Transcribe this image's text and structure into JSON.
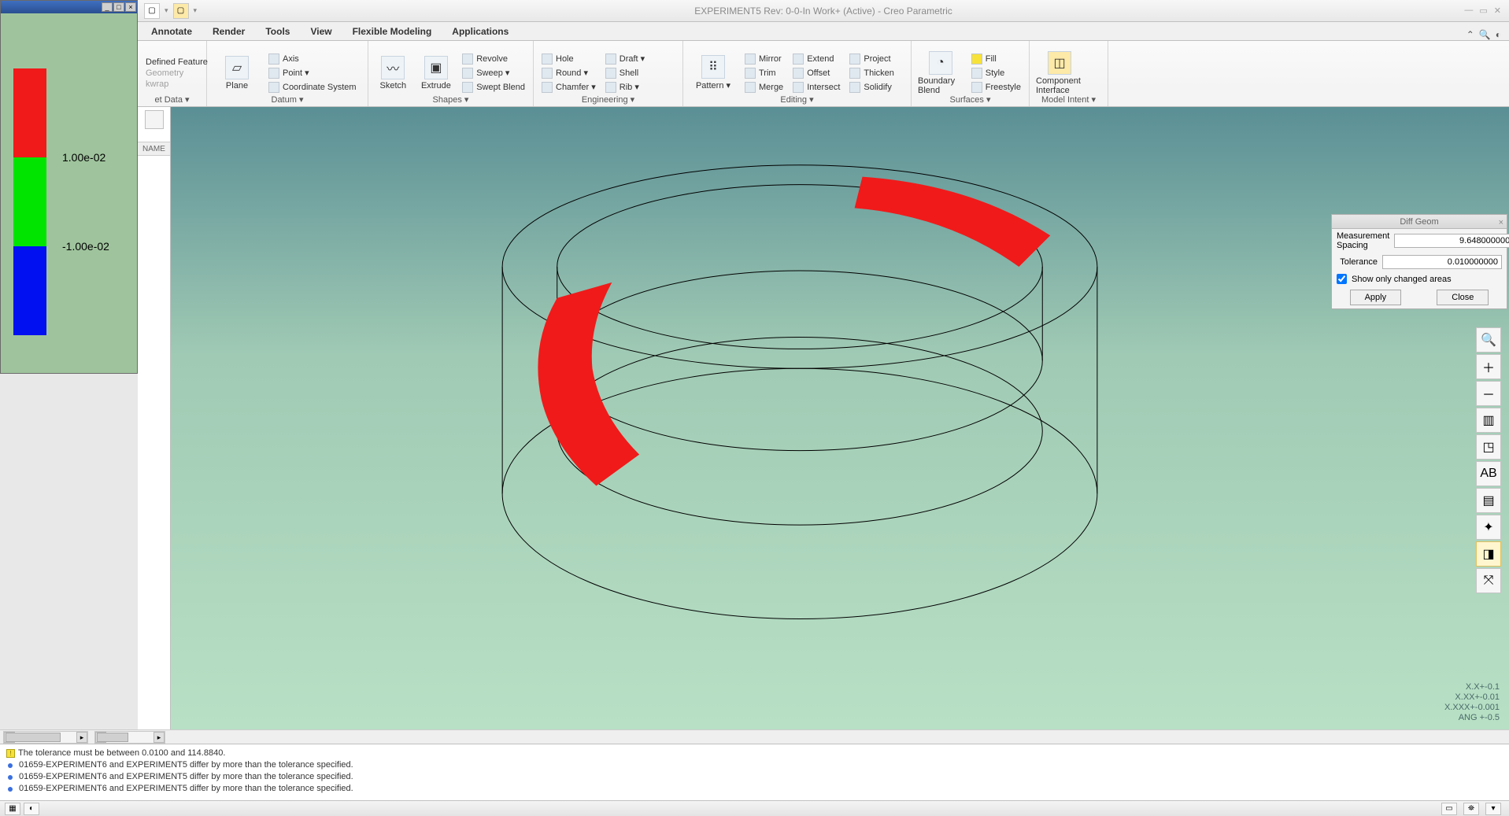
{
  "app": {
    "title": "EXPERIMENT5 Rev: 0-0-In Work+ (Active) - Creo Parametric"
  },
  "tabs": {
    "t0": "Annotate",
    "t1": "Render",
    "t2": "Tools",
    "t3": "View",
    "t4": "Flexible Modeling",
    "t5": "Applications"
  },
  "ribbon_groups": {
    "g0": "et Data ▾",
    "g1": "Datum ▾",
    "g2": "Shapes ▾",
    "g3": "Engineering ▾",
    "g4": "Editing ▾",
    "g5": "Surfaces ▾",
    "g6": "Model Intent ▾"
  },
  "rib": {
    "defined_feature": "Defined Feature",
    "geometry": "Geometry",
    "kwrap": "kwrap",
    "plane": "Plane",
    "axis": "Axis",
    "point": "Point ▾",
    "csys": "Coordinate System",
    "sketch": "Sketch",
    "extrude": "Extrude",
    "revolve": "Revolve",
    "sweep": "Sweep ▾",
    "swept_blend": "Swept Blend",
    "hole": "Hole",
    "round": "Round ▾",
    "chamfer": "Chamfer ▾",
    "draft": "Draft ▾",
    "shell": "Shell",
    "rib": "Rib ▾",
    "pattern": "Pattern ▾",
    "mirror": "Mirror",
    "trim": "Trim",
    "merge": "Merge",
    "extend": "Extend",
    "offset": "Offset",
    "intersect": "Intersect",
    "project": "Project",
    "thicken": "Thicken",
    "solidify": "Solidify",
    "boundary": "Boundary Blend",
    "fill": "Fill",
    "style": "Style",
    "freestyle": "Freestyle",
    "component_iface": "Component Interface"
  },
  "tree": {
    "header": "NAME"
  },
  "diffgeom": {
    "title": "Diff Geom",
    "spacing_label": "Measurement Spacing",
    "spacing_value": "9.648000000",
    "tol_label": "Tolerance",
    "tol_value": "0.010000000",
    "check_label": "Show only changed areas",
    "apply": "Apply",
    "close": "Close"
  },
  "legend": {
    "upper": "1.00e-02",
    "lower": "-1.00e-02"
  },
  "annot": {
    "l0": "X.X+-0.1",
    "l1": "X.XX+-0.01",
    "l2": "X.XXX+-0.001",
    "l3": "ANG +-0.5"
  },
  "messages": {
    "m0": "The tolerance must be between 0.0100 and 114.8840.",
    "m1": "01659-EXPERIMENT6 and EXPERIMENT5 differ by more than the tolerance specified.",
    "m2": "01659-EXPERIMENT6 and EXPERIMENT5 differ by more than the tolerance specified.",
    "m3": "01659-EXPERIMENT6 and EXPERIMENT5 differ by more than the tolerance specified."
  },
  "chart_data": {
    "type": "legend",
    "thresholds": [
      0.01,
      -0.01
    ],
    "colors": {
      "above": "#f01a1a",
      "within": "#00e400",
      "below": "#0010f0"
    }
  }
}
